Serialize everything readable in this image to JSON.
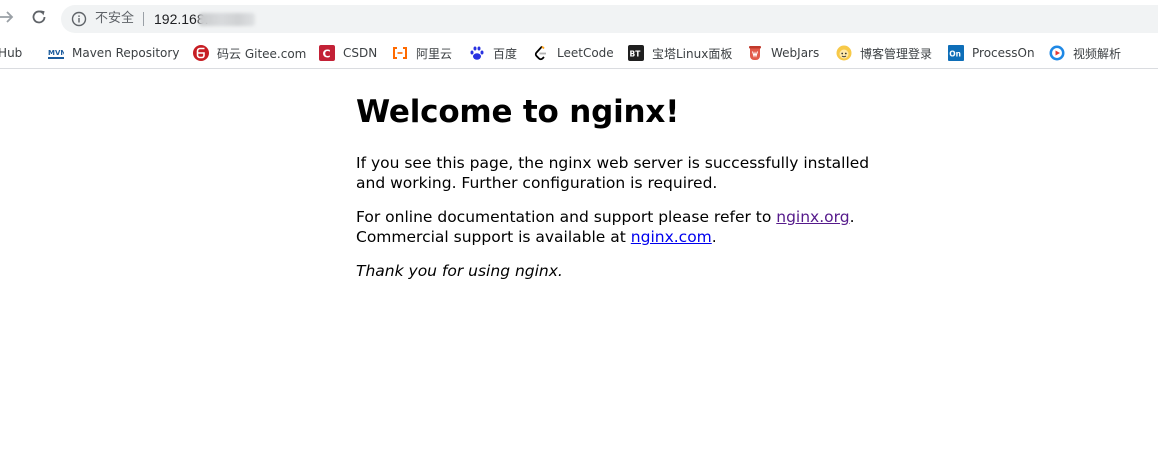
{
  "toolbar": {
    "back_icon": "arrow-right-icon",
    "reload_icon": "reload-icon",
    "address": {
      "security_icon": "info-icon",
      "security_label": "不安全",
      "url_visible": "192.168."
    }
  },
  "bookmarks": [
    {
      "label": "itHub",
      "icon": "github-icon"
    },
    {
      "label": "Maven Repository",
      "icon": "mvn-icon"
    },
    {
      "label": "码云 Gitee.com",
      "icon": "gitee-icon"
    },
    {
      "label": "CSDN",
      "icon": "csdn-icon"
    },
    {
      "label": "阿里云",
      "icon": "aliyun-icon"
    },
    {
      "label": "百度",
      "icon": "baidu-icon"
    },
    {
      "label": "LeetCode",
      "icon": "leetcode-icon"
    },
    {
      "label": "宝塔Linux面板",
      "icon": "bt-icon"
    },
    {
      "label": "WebJars",
      "icon": "webjars-icon"
    },
    {
      "label": "博客管理登录",
      "icon": "blog-icon"
    },
    {
      "label": "ProcessOn",
      "icon": "processon-icon"
    },
    {
      "label": "视频解析",
      "icon": "video-icon"
    }
  ],
  "page": {
    "heading": "Welcome to nginx!",
    "p1": "If you see this page, the nginx web server is successfully installed and working. Further configuration is required.",
    "p2_prefix": "For online documentation and support please refer to ",
    "p2_link1": "nginx.org",
    "p2_mid": ".",
    "p2_line2_prefix": "Commercial support is available at ",
    "p2_link2": "nginx.com",
    "p2_suffix": ".",
    "p3": "Thank you for using nginx."
  },
  "colors": {
    "visited_link": "#551a8b",
    "link": "#0000ee",
    "omnibox_bg": "#f1f3f4"
  }
}
